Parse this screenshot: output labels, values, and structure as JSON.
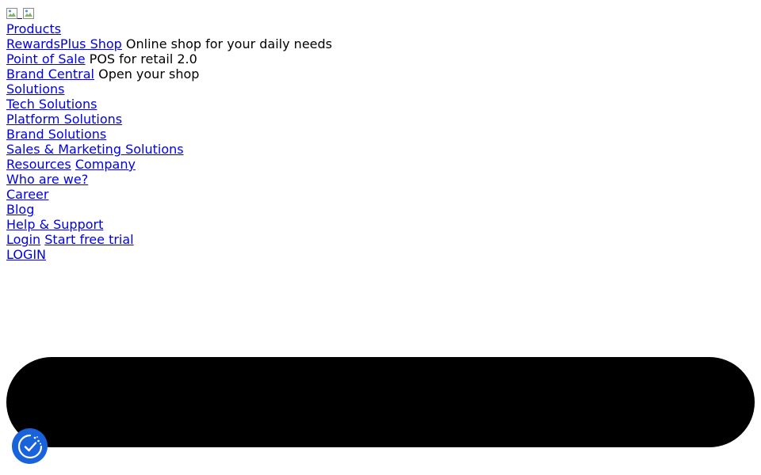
{
  "header": {
    "logo_images": [
      "logo-image",
      "logo-image-alt"
    ]
  },
  "nav": {
    "products": {
      "label": "Products",
      "items": [
        {
          "label": "RewardsPlus Shop",
          "description": "Online shop for your daily needs"
        },
        {
          "label": "Point of Sale",
          "description": "POS for retail 2.0"
        },
        {
          "label": "Brand Central",
          "description": "Open your shop"
        }
      ]
    },
    "solutions": {
      "label": "Solutions",
      "items": [
        {
          "label": "Tech Solutions"
        },
        {
          "label": "Platform Solutions"
        },
        {
          "label": "Brand Solutions"
        },
        {
          "label": "Sales & Marketing Solutions"
        }
      ]
    },
    "resources": {
      "label": "Resources"
    },
    "company": {
      "label": "Company",
      "items": [
        {
          "label": "Who are we?"
        },
        {
          "label": "Career"
        },
        {
          "label": "Blog"
        },
        {
          "label": "Help & Support"
        }
      ]
    },
    "login_label": "Login",
    "trial_label": "Start free trial",
    "login_upper_label": "LOGIN"
  },
  "colors": {
    "link": "#0000ee",
    "banner": "#000000",
    "consent_button": "#1863dc"
  },
  "consent": {
    "icon": "cookie-consent-check-icon"
  }
}
